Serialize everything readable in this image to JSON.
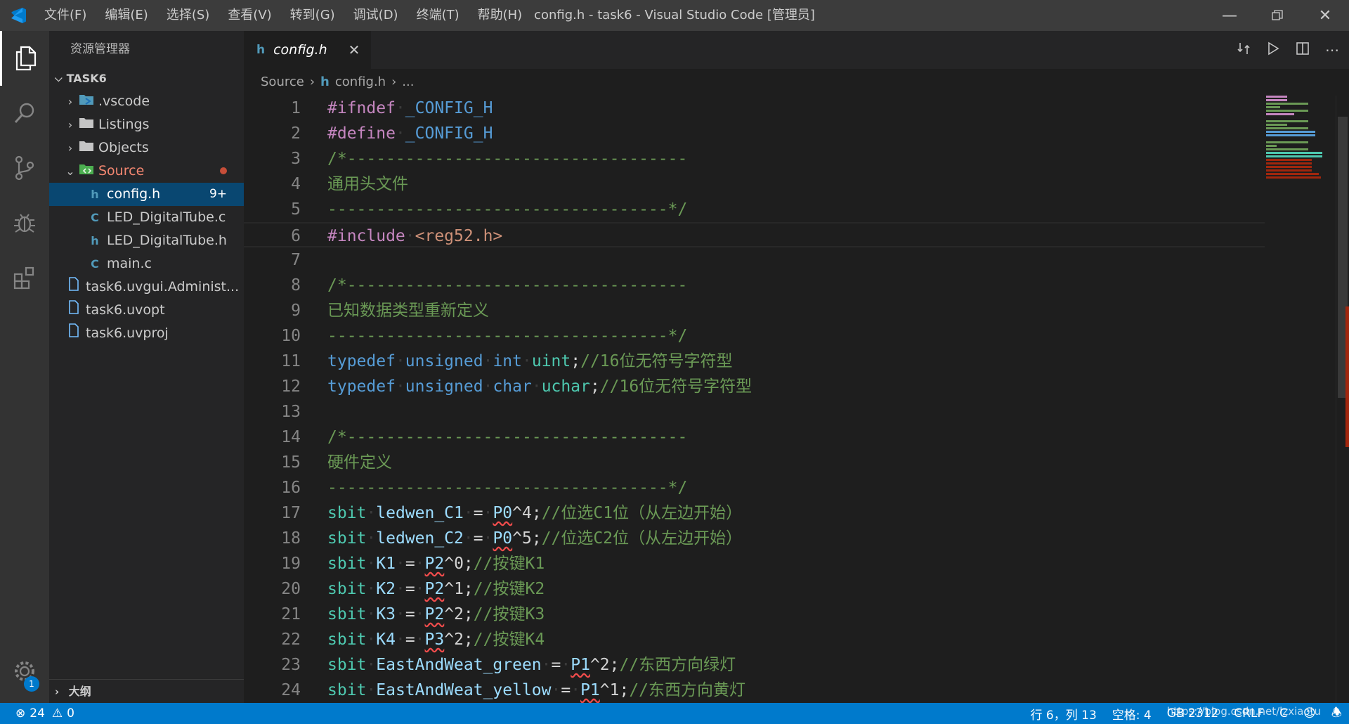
{
  "titlebar": {
    "title": "config.h - task6 - Visual Studio Code [管理员]",
    "menus": [
      "文件(F)",
      "编辑(E)",
      "选择(S)",
      "查看(V)",
      "转到(G)",
      "调试(D)",
      "终端(T)",
      "帮助(H)"
    ]
  },
  "activity": {
    "settings_badge": "1"
  },
  "sidebar": {
    "title": "资源管理器",
    "section": "TASK6",
    "items": [
      {
        "label": ".vscode",
        "chev": "›",
        "icon": "vscode-folder-icon",
        "indent": 1
      },
      {
        "label": "Listings",
        "chev": "›",
        "icon": "folder-icon",
        "indent": 1
      },
      {
        "label": "Objects",
        "chev": "›",
        "icon": "folder-icon",
        "indent": 1
      },
      {
        "label": "Source",
        "chev": "⌄",
        "icon": "source-folder-icon",
        "indent": 1
      },
      {
        "label": "config.h",
        "chev": "",
        "icon": "h",
        "indent": 2,
        "badge": "9+",
        "selected": true
      },
      {
        "label": "LED_DigitalTube.c",
        "chev": "",
        "icon": "C",
        "indent": 2
      },
      {
        "label": "LED_DigitalTube.h",
        "chev": "",
        "icon": "h",
        "indent": 2
      },
      {
        "label": "main.c",
        "chev": "",
        "icon": "C",
        "indent": 2
      },
      {
        "label": "task6.uvgui.Administ...",
        "chev": "",
        "icon": "file-icon",
        "indent": 1
      },
      {
        "label": "task6.uvopt",
        "chev": "",
        "icon": "file-icon",
        "indent": 1
      },
      {
        "label": "task6.uvproj",
        "chev": "",
        "icon": "file-icon",
        "indent": 1
      }
    ],
    "outline": "大纲"
  },
  "editor": {
    "tab_label": "config.h",
    "tab_icon": "h",
    "breadcrumb": [
      "Source",
      "config.h",
      "..."
    ],
    "lines": [
      {
        "n": "1",
        "tokens": [
          [
            "pp",
            "#ifndef"
          ],
          [
            "ws",
            "·"
          ],
          [
            "mac",
            "_CONFIG_H"
          ]
        ]
      },
      {
        "n": "2",
        "tokens": [
          [
            "pp",
            "#define"
          ],
          [
            "ws",
            "·"
          ],
          [
            "mac",
            "_CONFIG_H"
          ]
        ]
      },
      {
        "n": "3",
        "tokens": [
          [
            "cm",
            "/*-----------------------------------"
          ]
        ]
      },
      {
        "n": "4",
        "tokens": [
          [
            "cm",
            "通用头文件"
          ]
        ]
      },
      {
        "n": "5",
        "tokens": [
          [
            "cm",
            "-----------------------------------*/"
          ]
        ]
      },
      {
        "n": "6",
        "tokens": [
          [
            "pp",
            "#include"
          ],
          [
            "ws",
            "·"
          ],
          [
            "str",
            "<reg52.h>"
          ]
        ],
        "current": true
      },
      {
        "n": "7",
        "tokens": []
      },
      {
        "n": "8",
        "tokens": [
          [
            "cm",
            "/*-----------------------------------"
          ]
        ]
      },
      {
        "n": "9",
        "tokens": [
          [
            "cm",
            "已知数据类型重新定义"
          ]
        ]
      },
      {
        "n": "10",
        "tokens": [
          [
            "cm",
            "-----------------------------------*/"
          ]
        ]
      },
      {
        "n": "11",
        "tokens": [
          [
            "kw",
            "typedef"
          ],
          [
            "ws",
            "·"
          ],
          [
            "kw",
            "unsigned"
          ],
          [
            "ws",
            "·"
          ],
          [
            "kw",
            "int"
          ],
          [
            "ws",
            "·"
          ],
          [
            "ty",
            "uint"
          ],
          [
            "op",
            ";"
          ],
          [
            "cm",
            "//16位无符号字符型"
          ]
        ]
      },
      {
        "n": "12",
        "tokens": [
          [
            "kw",
            "typedef"
          ],
          [
            "ws",
            "·"
          ],
          [
            "kw",
            "unsigned"
          ],
          [
            "ws",
            "·"
          ],
          [
            "kw",
            "char"
          ],
          [
            "ws",
            "·"
          ],
          [
            "ty",
            "uchar"
          ],
          [
            "op",
            ";"
          ],
          [
            "cm",
            "//16位无符号字符型"
          ]
        ]
      },
      {
        "n": "13",
        "tokens": []
      },
      {
        "n": "14",
        "tokens": [
          [
            "cm",
            "/*-----------------------------------"
          ]
        ]
      },
      {
        "n": "15",
        "tokens": [
          [
            "cm",
            "硬件定义"
          ]
        ]
      },
      {
        "n": "16",
        "tokens": [
          [
            "cm",
            "-----------------------------------*/"
          ]
        ]
      },
      {
        "n": "17",
        "tokens": [
          [
            "ty",
            "sbit"
          ],
          [
            "ws",
            "·"
          ],
          [
            "id",
            "ledwen_C1"
          ],
          [
            "ws",
            "·"
          ],
          [
            "op",
            "="
          ],
          [
            "ws",
            "·"
          ],
          [
            "id sq",
            "P0"
          ],
          [
            "op",
            "^4;"
          ],
          [
            "cm",
            "//位选C1位（从左边开始）"
          ]
        ]
      },
      {
        "n": "18",
        "tokens": [
          [
            "ty",
            "sbit"
          ],
          [
            "ws",
            "·"
          ],
          [
            "id",
            "ledwen_C2"
          ],
          [
            "ws",
            "·"
          ],
          [
            "op",
            "="
          ],
          [
            "ws",
            "·"
          ],
          [
            "id sq",
            "P0"
          ],
          [
            "op",
            "^5;"
          ],
          [
            "cm",
            "//位选C2位（从左边开始）"
          ]
        ]
      },
      {
        "n": "19",
        "tokens": [
          [
            "ty",
            "sbit"
          ],
          [
            "ws",
            "·"
          ],
          [
            "id",
            "K1"
          ],
          [
            "ws",
            "·"
          ],
          [
            "op",
            "="
          ],
          [
            "ws",
            "·"
          ],
          [
            "id sq",
            "P2"
          ],
          [
            "op",
            "^0;"
          ],
          [
            "cm",
            "//按键K1"
          ]
        ]
      },
      {
        "n": "20",
        "tokens": [
          [
            "ty",
            "sbit"
          ],
          [
            "ws",
            "·"
          ],
          [
            "id",
            "K2"
          ],
          [
            "ws",
            "·"
          ],
          [
            "op",
            "="
          ],
          [
            "ws",
            "·"
          ],
          [
            "id sq",
            "P2"
          ],
          [
            "op",
            "^1;"
          ],
          [
            "cm",
            "//按键K2"
          ]
        ]
      },
      {
        "n": "21",
        "tokens": [
          [
            "ty",
            "sbit"
          ],
          [
            "ws",
            "·"
          ],
          [
            "id",
            "K3"
          ],
          [
            "ws",
            "·"
          ],
          [
            "op",
            "="
          ],
          [
            "ws",
            "·"
          ],
          [
            "id sq",
            "P2"
          ],
          [
            "op",
            "^2;"
          ],
          [
            "cm",
            "//按键K3"
          ]
        ]
      },
      {
        "n": "22",
        "tokens": [
          [
            "ty",
            "sbit"
          ],
          [
            "ws",
            "·"
          ],
          [
            "id",
            "K4"
          ],
          [
            "ws",
            "·"
          ],
          [
            "op",
            "="
          ],
          [
            "ws",
            "·"
          ],
          [
            "id sq",
            "P3"
          ],
          [
            "op",
            "^2;"
          ],
          [
            "cm",
            "//按键K4"
          ]
        ]
      },
      {
        "n": "23",
        "tokens": [
          [
            "ty",
            "sbit"
          ],
          [
            "ws",
            "·"
          ],
          [
            "id",
            "EastAndWeat_green"
          ],
          [
            "ws",
            "·"
          ],
          [
            "op",
            "="
          ],
          [
            "ws",
            "·"
          ],
          [
            "id sq",
            "P1"
          ],
          [
            "op",
            "^2;"
          ],
          [
            "cm",
            "//东西方向绿灯"
          ]
        ]
      },
      {
        "n": "24",
        "tokens": [
          [
            "ty",
            "sbit"
          ],
          [
            "ws",
            "·"
          ],
          [
            "id",
            "EastAndWeat_yellow"
          ],
          [
            "ws",
            "·"
          ],
          [
            "op",
            "="
          ],
          [
            "ws",
            "·"
          ],
          [
            "id sq",
            "P1"
          ],
          [
            "op",
            "^1;"
          ],
          [
            "cm",
            "//东西方向黄灯"
          ]
        ]
      }
    ]
  },
  "statusbar": {
    "errors": "24",
    "warnings": "0",
    "position": "行 6，列 13",
    "spaces": "空格: 4",
    "encoding": "GB 2312",
    "eol": "CRLF",
    "language": "C",
    "watermark": "https://blog.csdn.net/lzxiaotu"
  },
  "colors": {
    "accent": "#007acc",
    "selection": "#094771",
    "source_folder": "#f48771",
    "error": "#c74e39"
  }
}
